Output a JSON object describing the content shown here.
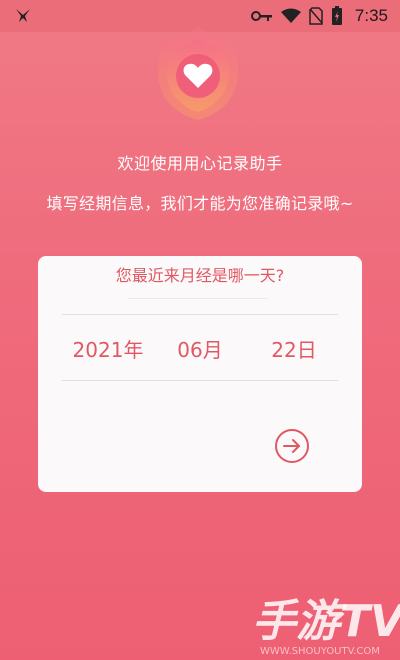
{
  "status_bar": {
    "time": "7:35"
  },
  "welcome": {
    "line1": "欢迎使用用心记录助手",
    "line2": "填写经期信息，我们才能为您准确记录哦~"
  },
  "card": {
    "question": "您最近来月经是哪一天?",
    "date": {
      "year": "2021年",
      "month": "06月",
      "day": "22日"
    }
  },
  "watermark": {
    "main": "手游TV",
    "url": "WWW.SHOUYOUTV.COM"
  },
  "colors": {
    "background": "#ef6c7d",
    "accent": "#e15864",
    "card": "#fbf9f9"
  },
  "icons": {
    "status_left": "notification-bird-icon",
    "next": "arrow-right-circle-icon",
    "logo": "heart-logo-icon"
  }
}
